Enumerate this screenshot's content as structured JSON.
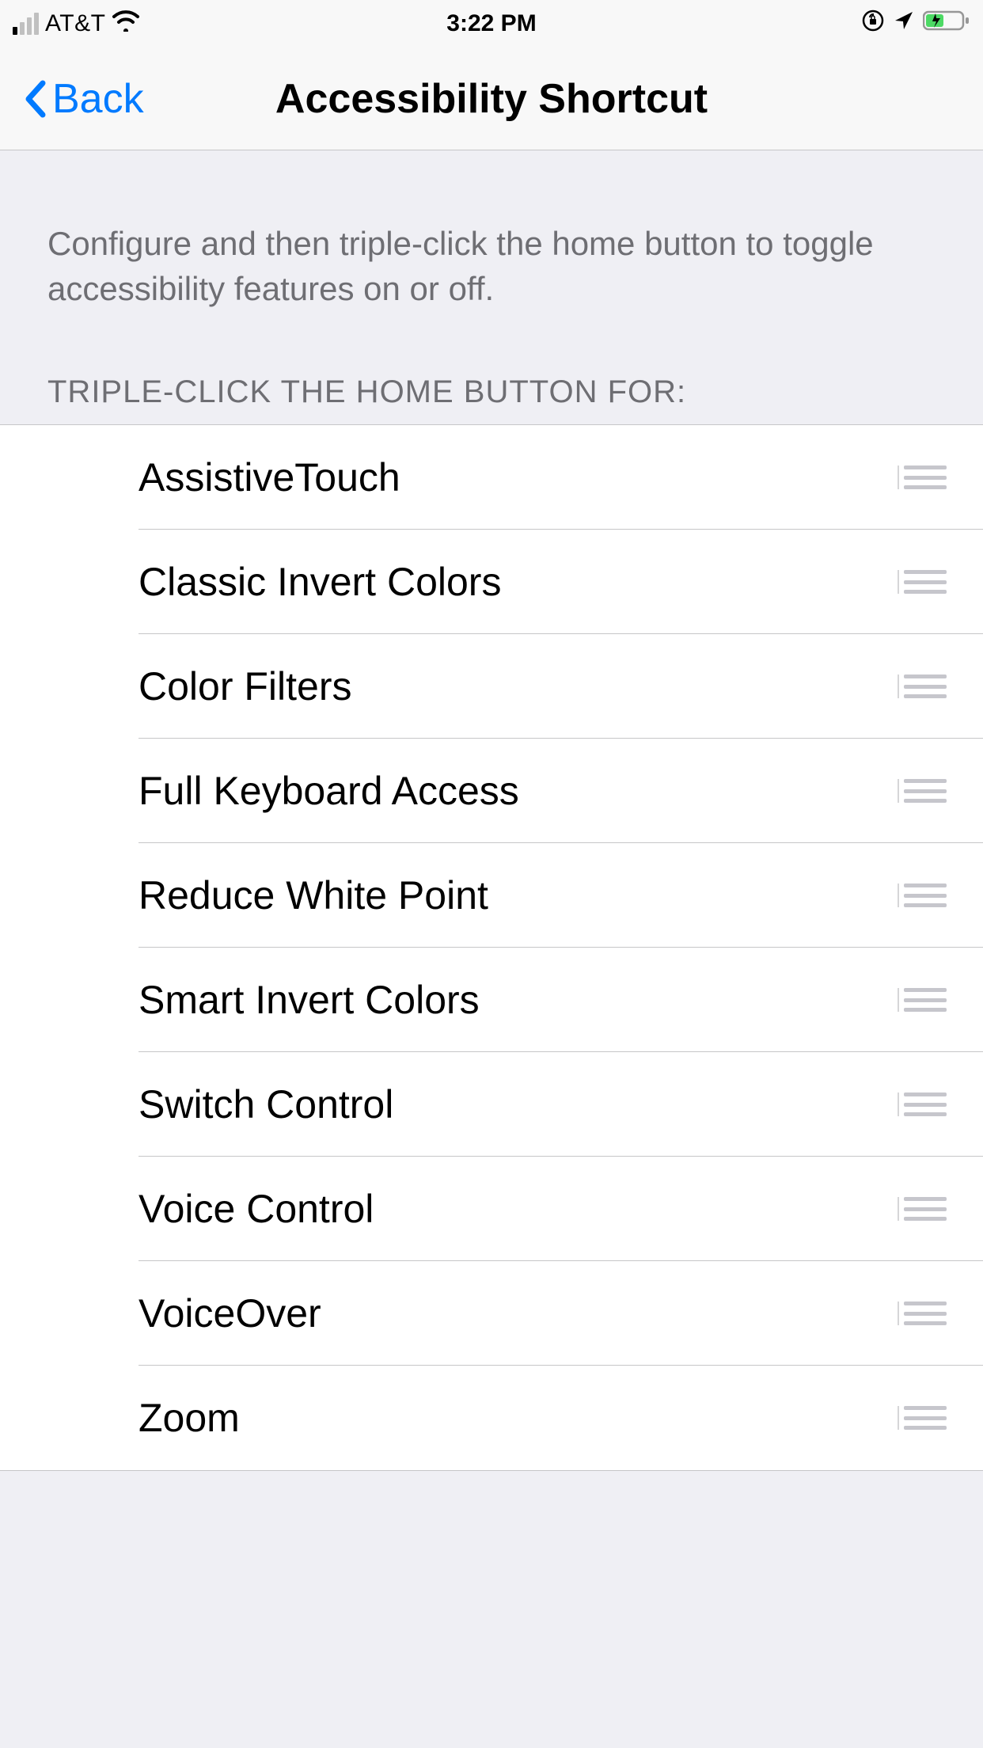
{
  "status_bar": {
    "carrier": "AT&T",
    "time": "3:22 PM"
  },
  "nav": {
    "back_label": "Back",
    "title": "Accessibility Shortcut"
  },
  "description": "Configure and then triple-click the home button to toggle accessibility features on or off.",
  "section_header": "TRIPLE-CLICK THE HOME BUTTON FOR:",
  "items": [
    {
      "label": "AssistiveTouch"
    },
    {
      "label": "Classic Invert Colors"
    },
    {
      "label": "Color Filters"
    },
    {
      "label": "Full Keyboard Access"
    },
    {
      "label": "Reduce White Point"
    },
    {
      "label": "Smart Invert Colors"
    },
    {
      "label": "Switch Control"
    },
    {
      "label": "Voice Control"
    },
    {
      "label": "VoiceOver"
    },
    {
      "label": "Zoom"
    }
  ]
}
